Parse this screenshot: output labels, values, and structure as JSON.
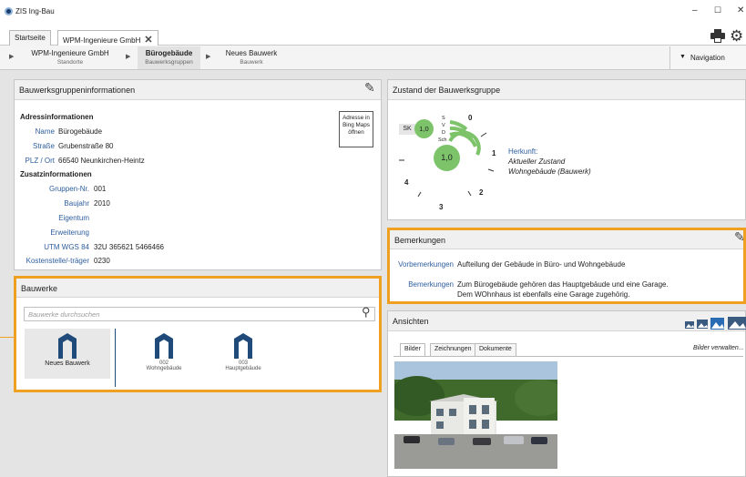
{
  "window": {
    "title": "ZIS Ing-Bau",
    "minimize": "–",
    "maximize": "☐",
    "close": "✕"
  },
  "tabs": [
    {
      "label": "Startseite"
    },
    {
      "label": "WPM-Ingenieure GmbH"
    }
  ],
  "breadcrumb": [
    {
      "label": "WPM-Ingenieure GmbH",
      "sub": "Standorte"
    },
    {
      "label": "Bürogebäude",
      "sub": "Bauwerksgruppen"
    },
    {
      "label": "Neues Bauwerk",
      "sub": "Bauwerk"
    }
  ],
  "navigation": {
    "label": "Navigation"
  },
  "info": {
    "title": "Bauwerksgruppeninformationen",
    "address_heading": "Adressinformationen",
    "name_label": "Name",
    "name": "Bürogebäude",
    "street_label": "Straße",
    "street": "Grubenstraße 80",
    "plz_label": "PLZ / Ort",
    "plz": "66540 Neunkirchen-Heintz",
    "extra_heading": "Zusatzinformationen",
    "group_label": "Gruppen-Nr.",
    "group": "001",
    "year_label": "Baujahr",
    "year": "2010",
    "owner_label": "Eigentum",
    "owner": "",
    "ext_label": "Erweiterung",
    "ext": "",
    "utm_label": "UTM WGS 84",
    "utm": "32U 365621 5466466",
    "cost_label": "Kostenstelle/-träger",
    "cost": "0230",
    "bing_button": "Adresse in Bing Maps öffnen"
  },
  "bauwerke": {
    "title": "Bauwerke",
    "search_placeholder": "Bauwerke durchsuchen",
    "items": [
      {
        "name": "Neues Bauwerk",
        "sub": ""
      },
      {
        "name": "002",
        "sub": "Wohngebäude"
      },
      {
        "name": "003",
        "sub": "Hauptgebäude"
      }
    ]
  },
  "zustand": {
    "title": "Zustand der Bauwerksgruppe",
    "sk_label": "SK",
    "sk_value": "1,0",
    "center_value": "1,0",
    "svd_labels": [
      "S",
      "V",
      "D",
      "Sch"
    ],
    "scale_labels": [
      "0",
      "1",
      "2",
      "3",
      "4"
    ],
    "legend_title": "Herkunft:",
    "legend_line1": "Aktueller Zustand",
    "legend_line2": "Wohngebäude (Bauwerk)",
    "accent": "#7cc36a"
  },
  "bemerkungen": {
    "title": "Bemerkungen",
    "vor_label": "Vorbemerkungen",
    "vor": "Aufteilung der Gebäude in Büro- und Wohngebäude",
    "bem_label": "Bemerkungen",
    "bem_line1": "Zum Bürogebäude gehören das Hauptgebäude und eine Garage.",
    "bem_line2": "Dem WOhnhaus ist ebenfalls eine Garage zugehörig."
  },
  "ansichten": {
    "title": "Ansichten",
    "tabs": [
      "Bilder",
      "Zeichnungen",
      "Dokumente"
    ],
    "manage": "Bilder verwalten..."
  }
}
